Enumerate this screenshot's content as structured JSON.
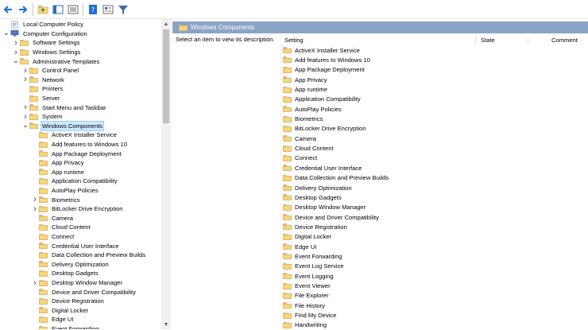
{
  "toolbar": {
    "buttons": [
      {
        "name": "back-icon",
        "glyph": "arrow-left",
        "color": "#1e6fd9"
      },
      {
        "name": "forward-icon",
        "glyph": "arrow-right",
        "color": "#1e6fd9"
      },
      {
        "name": "up-folder-icon",
        "glyph": "folder-up",
        "color": "#dcb67a"
      },
      {
        "name": "show-hide-tree-icon",
        "glyph": "pane",
        "color": "#2f6fb5"
      },
      {
        "name": "export-list-icon",
        "glyph": "list",
        "color": "#6b6b6b"
      },
      {
        "name": "help-icon",
        "glyph": "help",
        "color": "#1e6fd9"
      },
      {
        "name": "properties-icon",
        "glyph": "properties",
        "color": "#6b6b6b"
      },
      {
        "name": "filter-icon",
        "glyph": "filter",
        "color": "#3a6ea5"
      }
    ]
  },
  "tree": {
    "items": [
      {
        "label": "Local Computer Policy",
        "level": 0,
        "expander": "",
        "icon": "policy-icon"
      },
      {
        "label": "Computer Configuration",
        "level": 0,
        "expander": "v",
        "icon": "computer-icon"
      },
      {
        "label": "Software Settings",
        "level": 1,
        "expander": ">",
        "icon": "folder-icon"
      },
      {
        "label": "Windows Settings",
        "level": 1,
        "expander": ">",
        "icon": "folder-icon"
      },
      {
        "label": "Administrative Templates",
        "level": 1,
        "expander": "v",
        "icon": "folder-icon"
      },
      {
        "label": "Control Panel",
        "level": 2,
        "expander": ">",
        "icon": "folder-icon"
      },
      {
        "label": "Network",
        "level": 2,
        "expander": ">",
        "icon": "folder-icon"
      },
      {
        "label": "Printers",
        "level": 2,
        "expander": "",
        "icon": "folder-icon"
      },
      {
        "label": "Server",
        "level": 2,
        "expander": "",
        "icon": "folder-icon"
      },
      {
        "label": "Start Menu and Taskbar",
        "level": 2,
        "expander": ">",
        "icon": "folder-icon"
      },
      {
        "label": "System",
        "level": 2,
        "expander": ">",
        "icon": "folder-icon"
      },
      {
        "label": "Windows Components",
        "level": 2,
        "expander": "v",
        "icon": "folder-icon",
        "selected": true
      },
      {
        "label": "ActiveX Installer Service",
        "level": 3,
        "expander": "",
        "icon": "folder-icon"
      },
      {
        "label": "Add features to Windows 10",
        "level": 3,
        "expander": "",
        "icon": "folder-icon"
      },
      {
        "label": "App Package Deployment",
        "level": 3,
        "expander": "",
        "icon": "folder-icon"
      },
      {
        "label": "App Privacy",
        "level": 3,
        "expander": "",
        "icon": "folder-icon"
      },
      {
        "label": "App runtime",
        "level": 3,
        "expander": "",
        "icon": "folder-icon"
      },
      {
        "label": "Application Compatibility",
        "level": 3,
        "expander": "",
        "icon": "folder-icon"
      },
      {
        "label": "AutoPlay Policies",
        "level": 3,
        "expander": "",
        "icon": "folder-icon"
      },
      {
        "label": "Biometrics",
        "level": 3,
        "expander": ">",
        "icon": "folder-icon"
      },
      {
        "label": "BitLocker Drive Encryption",
        "level": 3,
        "expander": ">",
        "icon": "folder-icon"
      },
      {
        "label": "Camera",
        "level": 3,
        "expander": "",
        "icon": "folder-icon"
      },
      {
        "label": "Cloud Content",
        "level": 3,
        "expander": "",
        "icon": "folder-icon"
      },
      {
        "label": "Connect",
        "level": 3,
        "expander": "",
        "icon": "folder-icon"
      },
      {
        "label": "Credential User Interface",
        "level": 3,
        "expander": "",
        "icon": "folder-icon"
      },
      {
        "label": "Data Collection and Preview Builds",
        "level": 3,
        "expander": "",
        "icon": "folder-icon"
      },
      {
        "label": "Delivery Optimization",
        "level": 3,
        "expander": "",
        "icon": "folder-icon"
      },
      {
        "label": "Desktop Gadgets",
        "level": 3,
        "expander": "",
        "icon": "folder-icon"
      },
      {
        "label": "Desktop Window Manager",
        "level": 3,
        "expander": ">",
        "icon": "folder-icon"
      },
      {
        "label": "Device and Driver Compatibility",
        "level": 3,
        "expander": "",
        "icon": "folder-icon"
      },
      {
        "label": "Device Registration",
        "level": 3,
        "expander": "",
        "icon": "folder-icon"
      },
      {
        "label": "Digital Locker",
        "level": 3,
        "expander": "",
        "icon": "folder-icon"
      },
      {
        "label": "Edge UI",
        "level": 3,
        "expander": "",
        "icon": "folder-icon"
      },
      {
        "label": "Event Forwarding",
        "level": 3,
        "expander": "",
        "icon": "folder-icon"
      }
    ]
  },
  "right": {
    "header_title": "Windows Components",
    "description": "Select an item to view its description.",
    "columns": {
      "setting": "Setting",
      "state": "State",
      "comment": "Comment"
    },
    "rows": [
      "ActiveX Installer Service",
      "Add features to Windows 10",
      "App Package Deployment",
      "App Privacy",
      "App runtime",
      "Application Compatibility",
      "AutoPlay Policies",
      "Biometrics",
      "BitLocker Drive Encryption",
      "Camera",
      "Cloud Content",
      "Connect",
      "Credential User Interface",
      "Data Collection and Preview Builds",
      "Delivery Optimization",
      "Desktop Gadgets",
      "Desktop Window Manager",
      "Device and Driver Compatibility",
      "Device Registration",
      "Digital Locker",
      "Edge UI",
      "Event Forwarding",
      "Event Log Service",
      "Event Logging",
      "Event Viewer",
      "File Explorer",
      "File History",
      "Find My Device",
      "Handwriting"
    ]
  },
  "colors": {
    "header_bg": "#8ba3c7",
    "selection_bg": "#cce8ff",
    "folder": "#f8d775"
  }
}
